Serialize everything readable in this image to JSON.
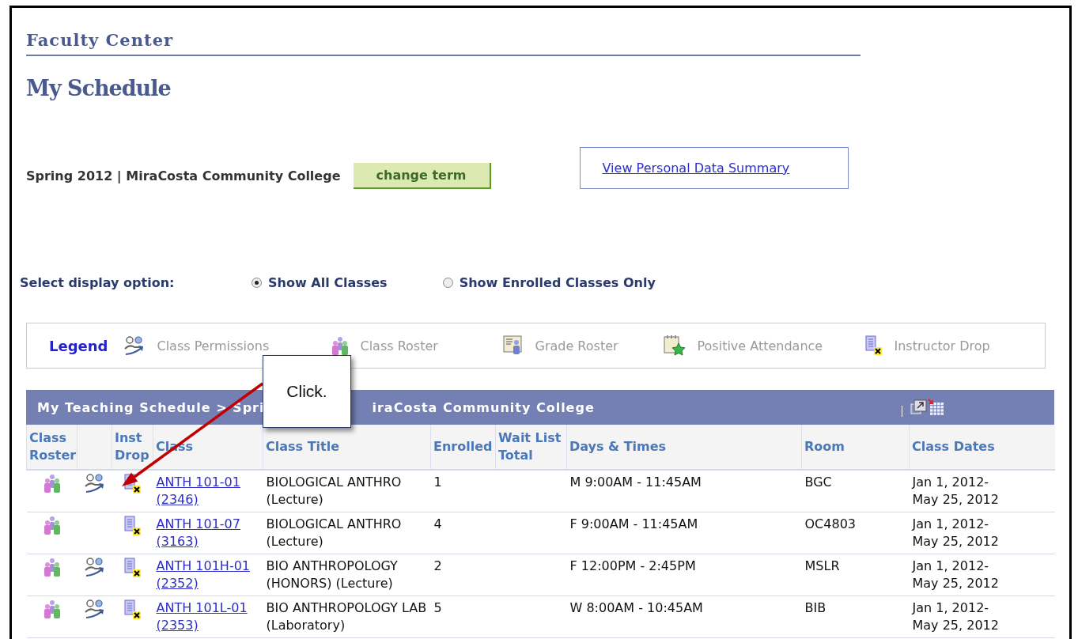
{
  "page": {
    "portal_title": "Faculty Center",
    "title": "My Schedule"
  },
  "term": {
    "label": "Spring 2012 | MiraCosta Community College",
    "button": "change term"
  },
  "personal_data_link": "View Personal Data Summary",
  "display_option": {
    "label": "Select display option:",
    "options": [
      {
        "label": "Show All Classes",
        "selected": true
      },
      {
        "label": "Show Enrolled Classes Only",
        "selected": false
      }
    ]
  },
  "legend": {
    "title": "Legend",
    "items": [
      {
        "kind": "permissions",
        "label": "Class Permissions"
      },
      {
        "kind": "roster",
        "label": "Class Roster"
      },
      {
        "kind": "grade",
        "label": "Grade Roster"
      },
      {
        "kind": "attendance",
        "label": "Positive Attendance"
      },
      {
        "kind": "drop",
        "label": "Instructor Drop"
      }
    ]
  },
  "table": {
    "title_start": "My Teaching Schedule > Spri",
    "title_end": "iraCosta Community College",
    "columns": [
      "Class Roster",
      "",
      "Inst Drop",
      "Class",
      "Class Title",
      "Enrolled",
      "Wait List Total",
      "Days & Times",
      "Room",
      "Class Dates"
    ],
    "rows": [
      {
        "roster": true,
        "permissions": true,
        "drop": true,
        "class": "ANTH 101-01 (2346)",
        "title": "BIOLOGICAL ANTHRO (Lecture)",
        "enrolled": "1",
        "wait": "",
        "days": "M 9:00AM - 11:45AM",
        "room": "BGC",
        "dates": "Jan 1, 2012- May 25, 2012"
      },
      {
        "roster": true,
        "permissions": false,
        "drop": true,
        "class": "ANTH 101-07 (3163)",
        "title": "BIOLOGICAL ANTHRO (Lecture)",
        "enrolled": "4",
        "wait": "",
        "days": "F 9:00AM - 11:45AM",
        "room": "OC4803",
        "dates": "Jan 1, 2012- May 25, 2012"
      },
      {
        "roster": true,
        "permissions": true,
        "drop": true,
        "class": "ANTH 101H-01 (2352)",
        "title": "BIO ANTHROPOLOGY (HONORS) (Lecture)",
        "enrolled": "2",
        "wait": "",
        "days": "F 12:00PM - 2:45PM",
        "room": "MSLR",
        "dates": "Jan 1, 2012- May 25, 2012"
      },
      {
        "roster": true,
        "permissions": true,
        "drop": true,
        "class": "ANTH 101L-01 (2353)",
        "title": "BIO ANTHROPOLOGY LAB (Laboratory)",
        "enrolled": "5",
        "wait": "",
        "days": "W 8:00AM - 10:45AM",
        "room": "BIB",
        "dates": "Jan 1, 2012- May 25, 2012"
      }
    ]
  },
  "callout": {
    "text": "Click."
  }
}
